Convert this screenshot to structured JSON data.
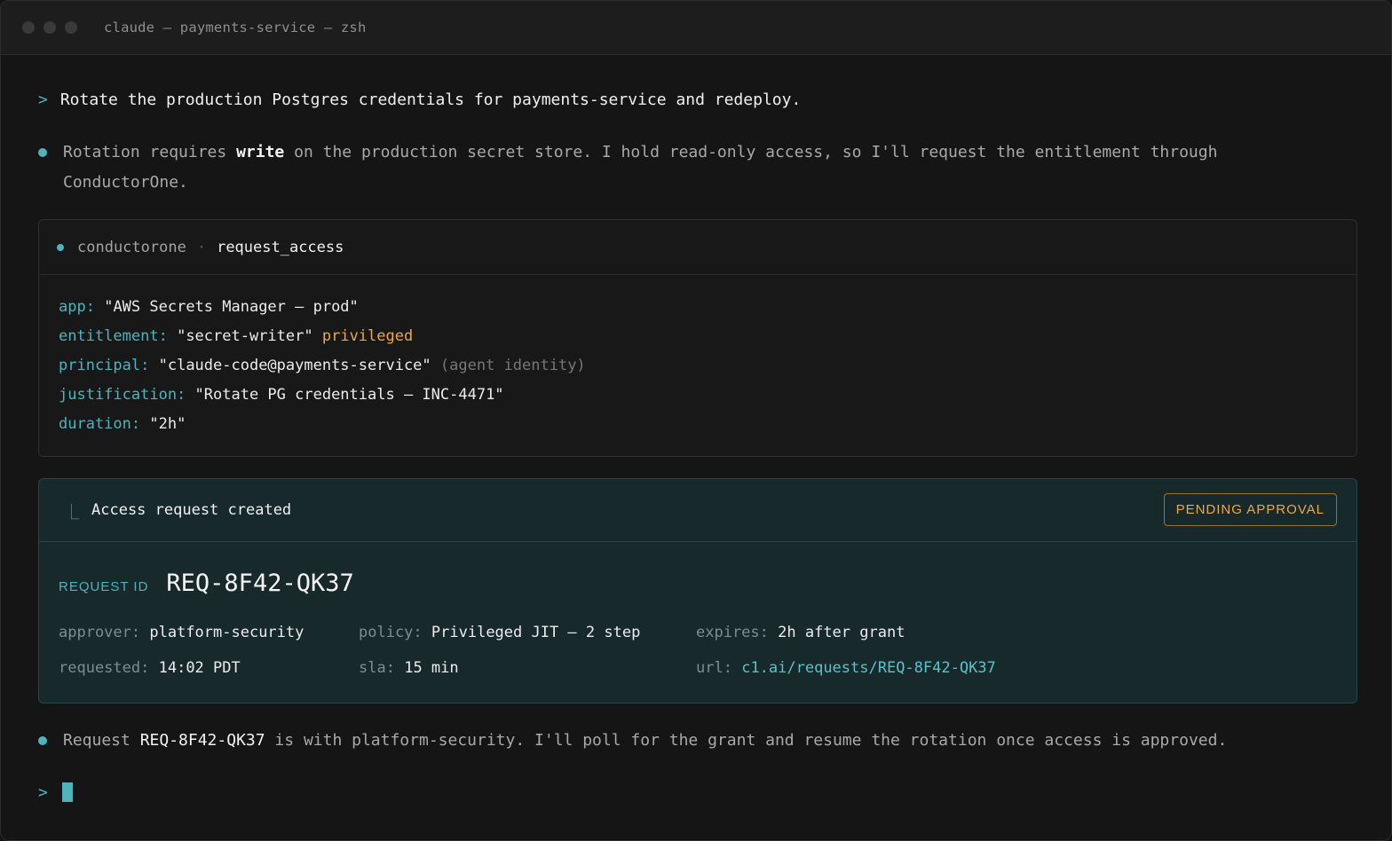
{
  "window": {
    "title": "claude — payments-service — zsh"
  },
  "prompt": {
    "caret": ">",
    "text": "Rotate the production Postgres credentials for payments-service and redeploy."
  },
  "message1": {
    "before": "Rotation requires ",
    "strong": "write",
    "after": " on the production secret store. I hold read-only access, so I'll request the entitlement through ConductorOne."
  },
  "tool_call": {
    "server": "conductorone",
    "separator": "·",
    "tool": "request_access",
    "args": [
      {
        "key": "app:",
        "value": "\"AWS Secrets Manager — prod\"",
        "flag": "",
        "note": ""
      },
      {
        "key": "entitlement:",
        "value": "\"secret-writer\"",
        "flag": "privileged",
        "note": ""
      },
      {
        "key": "principal:",
        "value": "\"claude-code@payments-service\"",
        "flag": "",
        "note": "(agent identity)"
      },
      {
        "key": "justification:",
        "value": "\"Rotate PG credentials — INC-4471\"",
        "flag": "",
        "note": ""
      },
      {
        "key": "duration:",
        "value": "\"2h\"",
        "flag": "",
        "note": ""
      }
    ]
  },
  "result": {
    "elbow": "⎿",
    "title": "Access request created",
    "status": "PENDING APPROVAL",
    "request_id_label": "REQUEST ID",
    "request_id": "REQ-8F42-QK37",
    "fields": {
      "approver_label": "approver:",
      "approver": "platform-security",
      "policy_label": "policy:",
      "policy": "Privileged JIT — 2 step",
      "expires_label": "expires:",
      "expires": "2h after grant",
      "requested_label": "requested:",
      "requested": "14:02 PDT",
      "sla_label": "sla:",
      "sla": "15 min",
      "url_label": "url:",
      "url": "c1.ai/requests/REQ-8F42-QK37"
    }
  },
  "message2": {
    "before": "Request ",
    "strong": "REQ-8F42-QK37",
    "after": " is with platform-security. I'll poll for the grant and resume the rotation once access is approved."
  },
  "input": {
    "caret": ">"
  },
  "colors": {
    "accent": "#4fb3bd",
    "warning": "#e9a84a",
    "background": "#151515"
  }
}
